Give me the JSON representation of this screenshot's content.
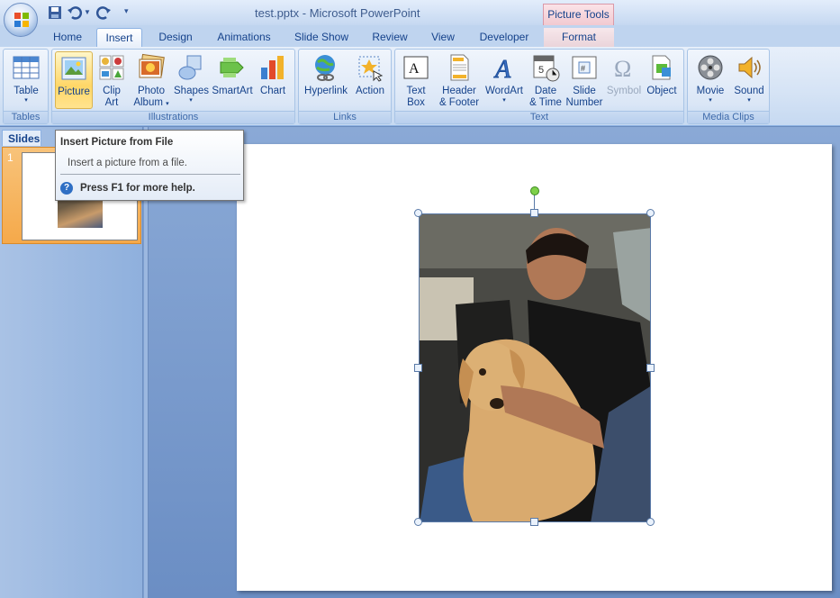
{
  "window": {
    "title": "test.pptx - Microsoft PowerPoint",
    "contextual_tab_group": "Picture Tools"
  },
  "tabs": [
    {
      "label": "Home"
    },
    {
      "label": "Insert",
      "active": true
    },
    {
      "label": "Design"
    },
    {
      "label": "Animations"
    },
    {
      "label": "Slide Show"
    },
    {
      "label": "Review"
    },
    {
      "label": "View"
    },
    {
      "label": "Developer"
    },
    {
      "label": "Format"
    }
  ],
  "ribbon": {
    "groups": {
      "tables": "Tables",
      "illustrations": "Illustrations",
      "links": "Links",
      "text": "Text",
      "media": "Media Clips"
    },
    "buttons": {
      "table": "Table",
      "picture": "Picture",
      "clipart1": "Clip",
      "clipart2": "Art",
      "album1": "Photo",
      "album2": "Album",
      "shapes": "Shapes",
      "smartart": "SmartArt",
      "chart": "Chart",
      "hyperlink": "Hyperlink",
      "action": "Action",
      "textbox1": "Text",
      "textbox2": "Box",
      "header1": "Header",
      "header2": "& Footer",
      "wordart": "WordArt",
      "date1": "Date",
      "date2": "& Time",
      "slidenum1": "Slide",
      "slidenum2": "Number",
      "symbol": "Symbol",
      "object": "Object",
      "movie": "Movie",
      "sound": "Sound"
    }
  },
  "slides_panel": {
    "tab_label": "Slides",
    "thumbnails": [
      {
        "number": "1"
      }
    ]
  },
  "tooltip": {
    "title": "Insert Picture from File",
    "description": "Insert a picture from a file.",
    "help": "Press F1 for more help."
  },
  "colors": {
    "accent": "#15428b",
    "ribbon_bg": "#d5e3f5",
    "hover": "#ffd767"
  }
}
